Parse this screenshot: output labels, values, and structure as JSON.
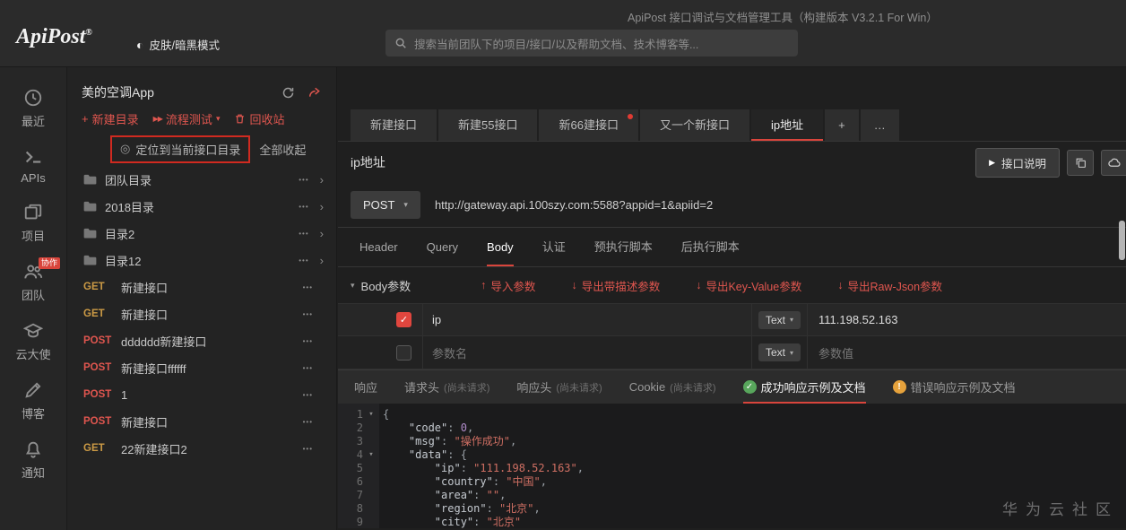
{
  "icons": {
    "plus": "+",
    "more": "•••",
    "chevron_right": "›",
    "caret_down": "▾",
    "fold": "▾",
    "check": "✓",
    "bang": "!",
    "moon": "◐",
    "target": "◎",
    "arrow_up": "↑",
    "arrow_down": "↓",
    "play": "▶",
    "fast_forward": "▶▶",
    "ellipsis": "…"
  },
  "colors": {
    "accent_red": "#e0564f",
    "get_method": "#cb9a45",
    "post_method": "#e0564f",
    "success_green": "#58a65c",
    "warn_orange": "#e6a23c"
  },
  "header": {
    "window_title": "ApiPost 接口调试与文档管理工具（构建版本 V3.2.1 For Win）",
    "logo_text": "ApiPost",
    "logo_reg": "®",
    "theme_toggle_label": "皮肤/暗黑模式",
    "search_placeholder": "搜索当前团队下的项目/接口/以及帮助文档、技术博客等..."
  },
  "nav_rail": {
    "items": [
      {
        "label": "最近"
      },
      {
        "label": "APIs"
      },
      {
        "label": "项目"
      },
      {
        "label": "团队",
        "badge": "协作"
      },
      {
        "label": "云大使"
      },
      {
        "label": "博客"
      },
      {
        "label": "通知"
      }
    ]
  },
  "tree": {
    "project_name": "美的空调App",
    "new_dir_label": "新建目录",
    "flow_test_label": "流程测试",
    "recycle_label": "回收站",
    "locate_label": "定位到当前接口目录",
    "collapse_all_label": "全部收起",
    "folders": [
      {
        "name": "团队目录"
      },
      {
        "name": "2018目录"
      },
      {
        "name": "目录2"
      },
      {
        "name": "目录12"
      }
    ],
    "apis": [
      {
        "method": "GET",
        "name": "新建接口"
      },
      {
        "method": "GET",
        "name": "新建接口"
      },
      {
        "method": "POST",
        "name": "dddddd新建接口"
      },
      {
        "method": "POST",
        "name": "新建接口ffffff"
      },
      {
        "method": "POST",
        "name": "1"
      },
      {
        "method": "POST",
        "name": "新建接口"
      },
      {
        "method": "GET",
        "name": "22新建接口2"
      }
    ]
  },
  "main": {
    "tabs": [
      {
        "label": "新建接口"
      },
      {
        "label": "新建55接口"
      },
      {
        "label": "新66建接口",
        "unsaved": true
      },
      {
        "label": "又一个新接口"
      },
      {
        "label": "ip地址",
        "active": true
      }
    ],
    "title": "ip地址",
    "doc_button_label": "接口说明",
    "request": {
      "method": "POST",
      "url": "http://gateway.api.100szy.com:5588?appid=1&apiid=2"
    },
    "request_tabs": [
      {
        "label": "Header"
      },
      {
        "label": "Query"
      },
      {
        "label": "Body",
        "active": true
      },
      {
        "label": "认证"
      },
      {
        "label": "预执行脚本"
      },
      {
        "label": "后执行脚本"
      }
    ],
    "body_panel": {
      "title": "Body参数",
      "import_label": "导入参数",
      "export_desc_label": "导出带描述参数",
      "export_kv_label": "导出Key-Value参数",
      "export_raw_label": "导出Raw-Json参数"
    },
    "params": [
      {
        "checked": true,
        "name": "ip",
        "type": "Text",
        "value": "111.198.52.163"
      },
      {
        "checked": false,
        "name_placeholder": "参数名",
        "type": "Text",
        "value_placeholder": "参数值"
      }
    ],
    "response_tabs": [
      {
        "label": "响应"
      },
      {
        "label": "请求头",
        "hint": "(尚未请求)"
      },
      {
        "label": "响应头",
        "hint": "(尚未请求)"
      },
      {
        "label": "Cookie",
        "hint": "(尚未请求)"
      },
      {
        "label": "成功响应示例及文档",
        "active": true
      },
      {
        "label": "错误响应示例及文档"
      }
    ],
    "code": {
      "lines": [
        {
          "num": "1",
          "fold": true,
          "tokens": [
            [
              "p",
              "{"
            ]
          ]
        },
        {
          "num": "2",
          "tokens": [
            [
              "w",
              "    "
            ],
            [
              "k",
              "\"code\""
            ],
            [
              "p",
              ": "
            ],
            [
              "n",
              "0"
            ],
            [
              "p",
              ","
            ]
          ]
        },
        {
          "num": "3",
          "tokens": [
            [
              "w",
              "    "
            ],
            [
              "k",
              "\"msg\""
            ],
            [
              "p",
              ": "
            ],
            [
              "s",
              "\"操作成功\""
            ],
            [
              "p",
              ","
            ]
          ]
        },
        {
          "num": "4",
          "fold": true,
          "tokens": [
            [
              "w",
              "    "
            ],
            [
              "k",
              "\"data\""
            ],
            [
              "p",
              ": "
            ],
            [
              "p",
              "{"
            ]
          ]
        },
        {
          "num": "5",
          "tokens": [
            [
              "w",
              "        "
            ],
            [
              "k",
              "\"ip\""
            ],
            [
              "p",
              ": "
            ],
            [
              "s",
              "\"111.198.52.163\""
            ],
            [
              "p",
              ","
            ]
          ]
        },
        {
          "num": "6",
          "tokens": [
            [
              "w",
              "        "
            ],
            [
              "k",
              "\"country\""
            ],
            [
              "p",
              ": "
            ],
            [
              "s",
              "\"中国\""
            ],
            [
              "p",
              ","
            ]
          ]
        },
        {
          "num": "7",
          "tokens": [
            [
              "w",
              "        "
            ],
            [
              "k",
              "\"area\""
            ],
            [
              "p",
              ": "
            ],
            [
              "s",
              "\"\""
            ],
            [
              "p",
              ","
            ]
          ]
        },
        {
          "num": "8",
          "tokens": [
            [
              "w",
              "        "
            ],
            [
              "k",
              "\"region\""
            ],
            [
              "p",
              ": "
            ],
            [
              "s",
              "\"北京\""
            ],
            [
              "p",
              ","
            ]
          ]
        },
        {
          "num": "9",
          "tokens": [
            [
              "w",
              "        "
            ],
            [
              "k",
              "\"city\""
            ],
            [
              "p",
              ": "
            ],
            [
              "s",
              "\"北京\""
            ]
          ]
        }
      ]
    }
  },
  "watermark": "华为云社区"
}
